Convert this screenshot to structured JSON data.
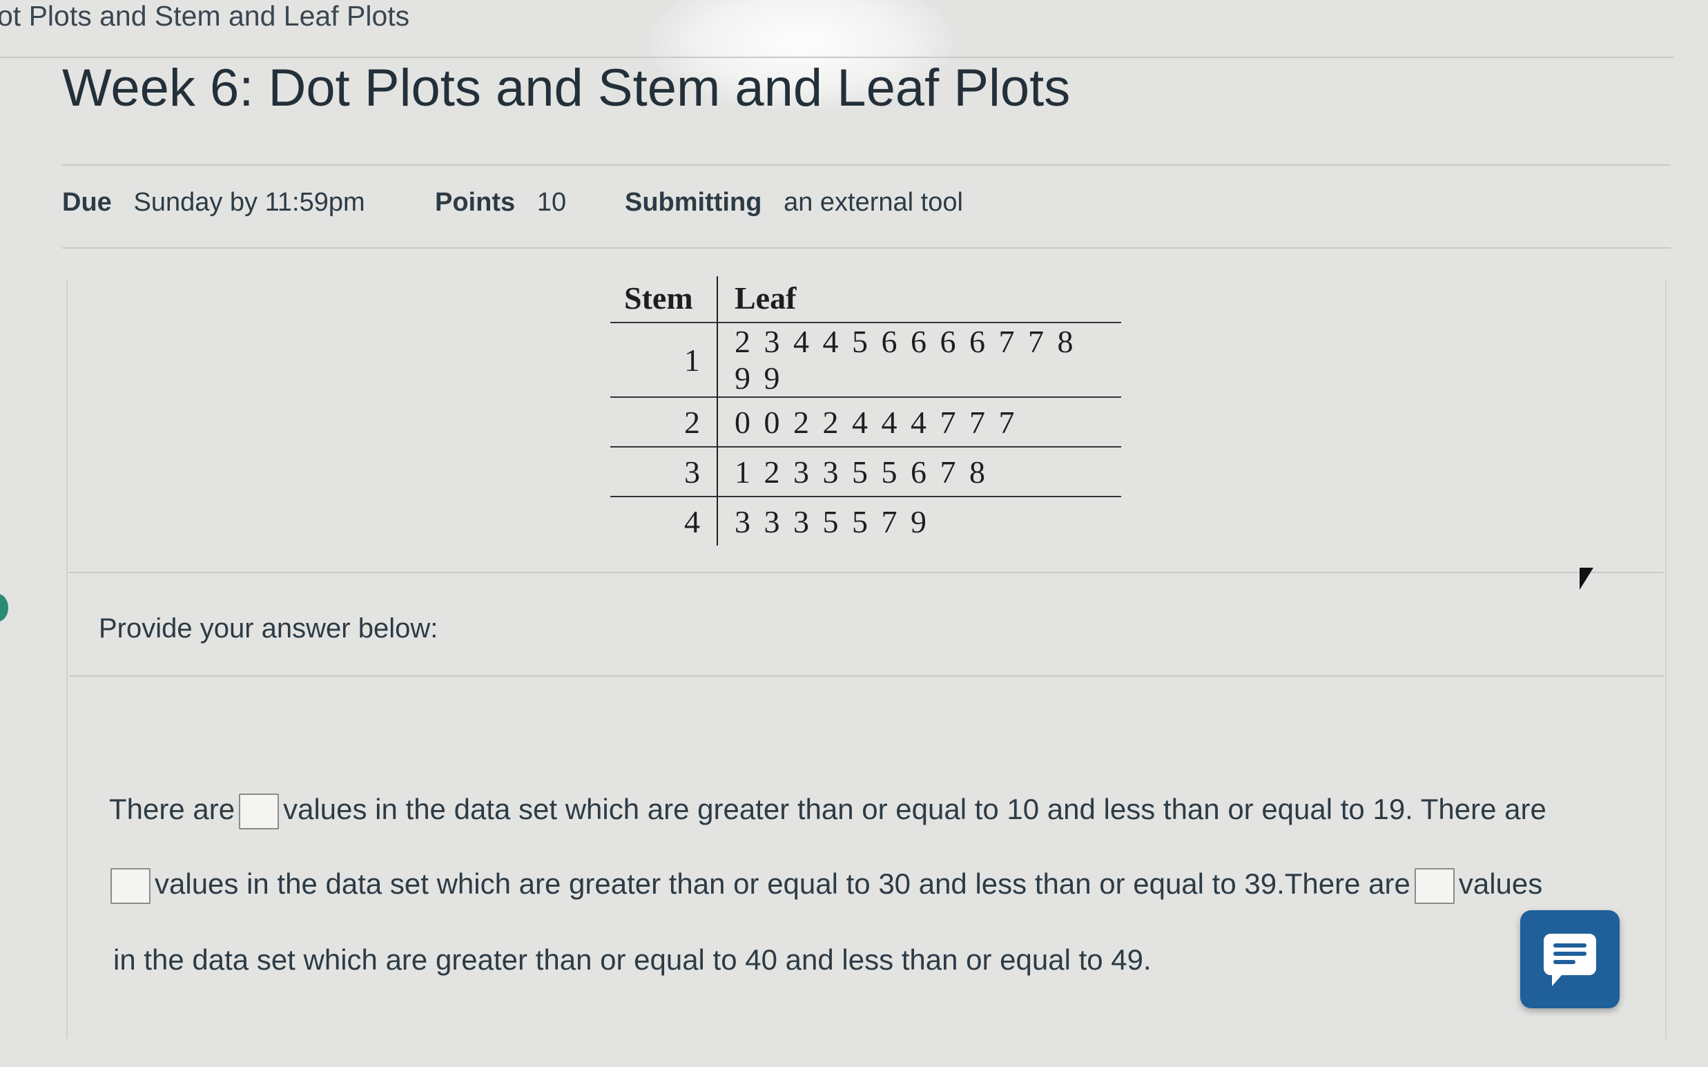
{
  "breadcrumb": "ot Plots and Stem and Leaf Plots",
  "title": "Week 6: Dot Plots and Stem and Leaf Plots",
  "meta": {
    "due_label": "Due",
    "due_value": "Sunday by 11:59pm",
    "points_label": "Points",
    "points_value": "10",
    "submitting_label": "Submitting",
    "submitting_value": "an external tool"
  },
  "stem_leaf": {
    "headers": {
      "stem": "Stem",
      "leaf": "Leaf"
    },
    "rows": [
      {
        "stem": "1",
        "leaf": "2 3 4 4 5 6 6 6 6 7 7 8 9 9"
      },
      {
        "stem": "2",
        "leaf": "0 0 2 2 4 4 4 7 7 7"
      },
      {
        "stem": "3",
        "leaf": "1 2 3 3 5 5 6 7 8"
      },
      {
        "stem": "4",
        "leaf": "3 3 3 5 5 7 9"
      }
    ]
  },
  "prompt": "Provide your answer below:",
  "question": {
    "l1_a": "There are",
    "l1_b": "values in the data set which are greater than or equal to 10 and less than or equal to 19. There are",
    "l2_a": "values in the data set which are greater than or equal to 30 and less than or equal to 39.There are",
    "l2_b": "values",
    "l3": "in the data set which are greater than or equal to 40 and less than or equal to 49."
  },
  "icons": {
    "chat": "chat-icon",
    "cursor": "mouse-pointer-icon"
  },
  "colors": {
    "chat_button": "#1f5f9a",
    "accent_dot": "#2b8a74"
  }
}
